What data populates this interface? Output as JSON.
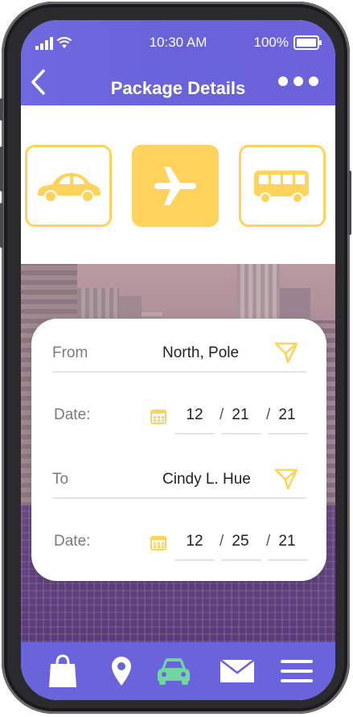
{
  "status_bar": {
    "time": "10:30 AM",
    "battery_percent": "100%"
  },
  "header": {
    "title": "Package Details",
    "back_icon": "chevron-left-icon",
    "more_icon": "more-horizontal-icon"
  },
  "transport_modes": [
    {
      "icon": "car-icon",
      "selected": false
    },
    {
      "icon": "airplane-icon",
      "selected": true
    },
    {
      "icon": "bus-icon",
      "selected": false
    }
  ],
  "form": {
    "from": {
      "label": "From",
      "value": "North, Pole"
    },
    "from_date": {
      "label": "Date:",
      "month": "12",
      "day": "21",
      "year": "21"
    },
    "to": {
      "label": "To",
      "value": "Cindy L. Hue"
    },
    "to_date": {
      "label": "Date:",
      "month": "12",
      "day": "25",
      "year": "21"
    },
    "separator": "/"
  },
  "tab_bar": [
    {
      "icon": "shopping-bag-icon",
      "active": false
    },
    {
      "icon": "location-pin-icon",
      "active": false
    },
    {
      "icon": "car-icon",
      "active": true
    },
    {
      "icon": "mail-icon",
      "active": false
    },
    {
      "icon": "menu-icon",
      "active": false
    }
  ],
  "colors": {
    "primary": "#6b63dc",
    "accent": "#ffd25c",
    "active_tab": "#6fd6a0"
  }
}
